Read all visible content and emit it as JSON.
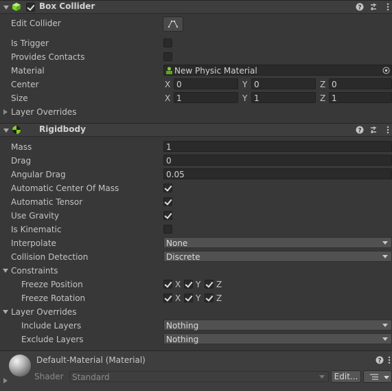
{
  "box_collider": {
    "title": "Box Collider",
    "enabled": true,
    "edit_collider_label": "Edit Collider",
    "is_trigger_label": "Is Trigger",
    "provides_contacts_label": "Provides Contacts",
    "material_label": "Material",
    "material_value": "New Physic Material",
    "center_label": "Center",
    "center": {
      "x_label": "X",
      "x": "0",
      "y_label": "Y",
      "y": "0",
      "z_label": "Z",
      "z": "0"
    },
    "size_label": "Size",
    "size": {
      "x_label": "X",
      "x": "1",
      "y_label": "Y",
      "y": "1",
      "z_label": "Z",
      "z": "1"
    },
    "layer_overrides_label": "Layer Overrides"
  },
  "rigidbody": {
    "title": "Rigidbody",
    "mass_label": "Mass",
    "mass": "1",
    "drag_label": "Drag",
    "drag": "0",
    "angular_drag_label": "Angular Drag",
    "angular_drag": "0.05",
    "auto_com_label": "Automatic Center Of Mass",
    "auto_tensor_label": "Automatic Tensor",
    "use_gravity_label": "Use Gravity",
    "is_kinematic_label": "Is Kinematic",
    "interpolate_label": "Interpolate",
    "interpolate": "None",
    "collision_label": "Collision Detection",
    "collision": "Discrete",
    "constraints_label": "Constraints",
    "freeze_position_label": "Freeze Position",
    "freeze_rotation_label": "Freeze Rotation",
    "axis_x": "X",
    "axis_y": "Y",
    "axis_z": "Z",
    "layer_overrides_label": "Layer Overrides",
    "include_layers_label": "Include Layers",
    "include_layers": "Nothing",
    "exclude_layers_label": "Exclude Layers",
    "exclude_layers": "Nothing"
  },
  "material": {
    "title": "Default-Material (Material)",
    "shader_label": "Shader",
    "shader_value": "Standard",
    "edit_label": "Edit..."
  },
  "colors": {
    "background": "#383838",
    "header": "#3e3e3e",
    "field": "#2a2a2a",
    "dropdown": "#515151",
    "accent_green": "#7ed321"
  }
}
